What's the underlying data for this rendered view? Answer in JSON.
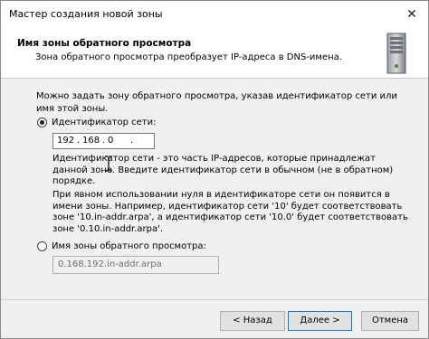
{
  "window": {
    "title": "Мастер создания новой зоны",
    "close_glyph": "✕"
  },
  "header": {
    "title": "Имя зоны обратного просмотра",
    "subtitle": "Зона обратного просмотра преобразует IP-адреса в DNS-имена.",
    "icon": "server-icon"
  },
  "content": {
    "intro": "Можно задать зону обратного просмотра, указав идентификатор сети или имя этой зоны.",
    "network_id": {
      "label": "Идентификатор сети:",
      "selected": true,
      "octets": [
        "192",
        "168",
        "0",
        ""
      ]
    },
    "note1": "Идентификатор сети - это часть IP-адресов, которые принадлежат данной зоне. Введите идентификатор сети в обычном (не в обратном) порядке.",
    "note2": "При явном использовании нуля в идентификаторе сети он появится в имени зоны. Например, идентификатор сети '10' будет соответствовать зоне '10.in-addr.arpa', а идентификатор сети '10.0' будет соответствовать зоне '0.10.in-addr.arpa'.",
    "zone_name": {
      "label": "Имя зоны обратного просмотра:",
      "selected": false,
      "value": "0.168.192.in-addr.arpa"
    }
  },
  "buttons": {
    "back": "< Назад",
    "next": "Далее >",
    "cancel": "Отмена"
  }
}
